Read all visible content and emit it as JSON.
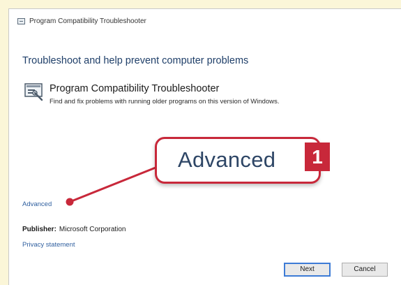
{
  "window": {
    "title": "Program Compatibility Troubleshooter"
  },
  "main": {
    "heading": "Troubleshoot and help prevent computer problems",
    "item": {
      "title": "Program Compatibility Troubleshooter",
      "description": "Find and fix problems with running older programs on this version of Windows.",
      "icon": "troubleshooter-icon"
    },
    "advanced_link": "Advanced",
    "publisher_label": "Publisher:",
    "publisher_value": "Microsoft Corporation",
    "privacy_link": "Privacy statement"
  },
  "buttons": {
    "next": "Next",
    "cancel": "Cancel"
  },
  "callout": {
    "text": "Advanced",
    "badge": "1",
    "accent_color": "#c8283a"
  }
}
